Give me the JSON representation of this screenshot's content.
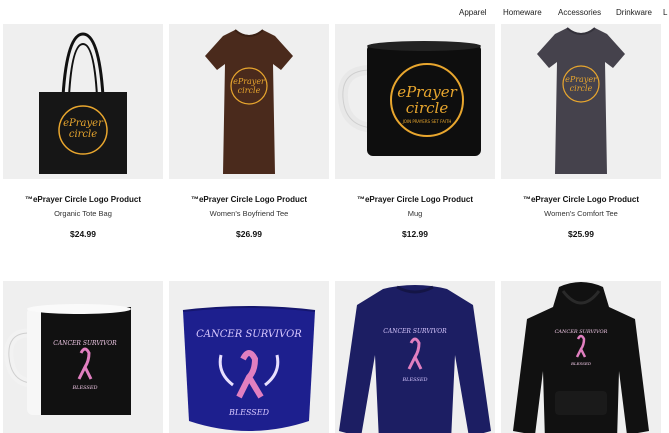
{
  "nav": {
    "items": [
      "Apparel",
      "Homeware",
      "Accessories",
      "Drinkware",
      "L"
    ]
  },
  "colors": {
    "card_background": "#efefef",
    "logo_gold": "#e8a62e",
    "ribbon_pink": "#e17fc0"
  },
  "logo": {
    "line1": "ePrayer",
    "line2": "circle",
    "tagline": "JOIN PRAYERS SET FAITH"
  },
  "products": [
    {
      "title": "™ePrayer Circle Logo Product",
      "type": "Organic Tote Bag",
      "price": "$24.99",
      "icon": "tote-bag-icon"
    },
    {
      "title": "™ePrayer Circle Logo Product",
      "type": "Women's Boyfriend Tee",
      "price": "$26.99",
      "icon": "tshirt-brown-icon"
    },
    {
      "title": "™ePrayer Circle Logo Product",
      "type": "Mug",
      "price": "$12.99",
      "icon": "mug-black-icon"
    },
    {
      "title": "™ePrayer Circle Logo Product",
      "type": "Women's Comfort Tee",
      "price": "$25.99",
      "icon": "tshirt-charcoal-icon"
    }
  ],
  "cancer_products": [
    {
      "icon": "mug-cancer-survivor-icon",
      "text_top": "CANCER SURVIVOR",
      "text_bottom": "BLESSED"
    },
    {
      "icon": "face-mask-cancer-survivor-icon",
      "text_top": "CANCER SURVIVOR",
      "text_bottom": "BLESSED"
    },
    {
      "icon": "sweatshirt-cancer-survivor-icon",
      "text_top": "CANCER SURVIVOR",
      "text_bottom": "BLESSED"
    },
    {
      "icon": "hoodie-cancer-survivor-icon",
      "text_top": "CANCER SURVIVOR",
      "text_bottom": "BLESSED"
    }
  ]
}
